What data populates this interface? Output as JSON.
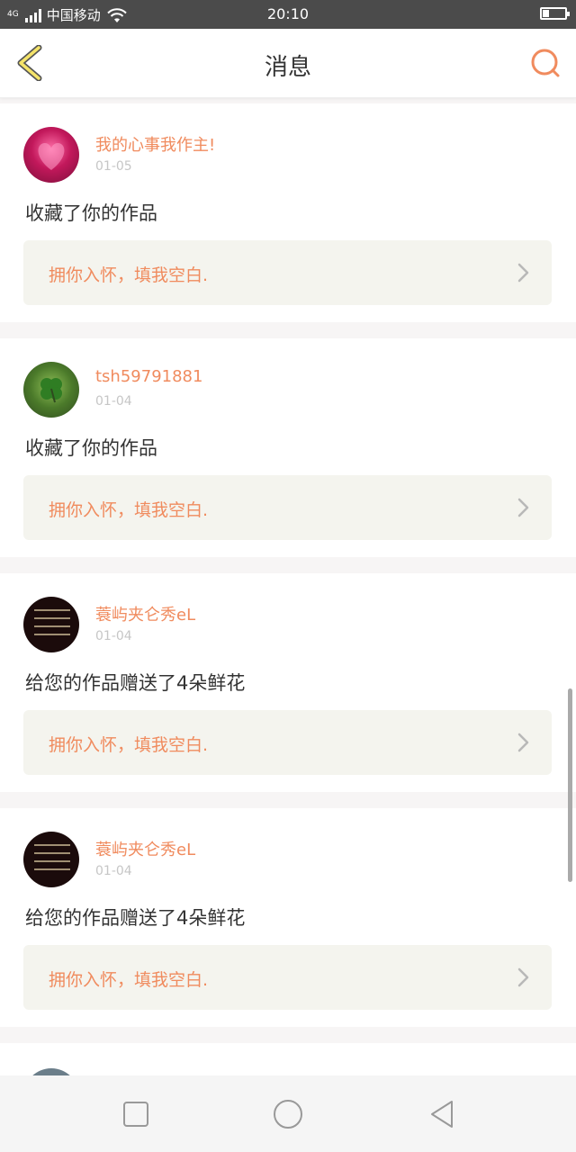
{
  "status_bar": {
    "network": "4G",
    "carrier": "中国移动",
    "time": "20:10",
    "battery_level": 0.25
  },
  "header": {
    "title": "消息",
    "back_icon": "chevron-left-icon",
    "search_icon": "search-icon",
    "accent_color": "#f08b5e"
  },
  "messages": [
    {
      "user": "我的心事我作主!",
      "date": "01-05",
      "action": "收藏了你的作品",
      "work_title": "拥你入怀，填我空白."
    },
    {
      "user": "tsh59791881",
      "date": "01-04",
      "action": "收藏了你的作品",
      "work_title": "拥你入怀，填我空白."
    },
    {
      "user": "蓑屿夹仑秀eL",
      "date": "01-04",
      "action": "给您的作品赠送了4朵鲜花",
      "work_title": "拥你入怀，填我空白."
    },
    {
      "user": "蓑屿夹仑秀eL",
      "date": "01-04",
      "action": "给您的作品赠送了4朵鲜花",
      "work_title": "拥你入怀，填我空白."
    }
  ],
  "nav_bar": {
    "recent_icon": "square-icon",
    "home_icon": "circle-icon",
    "back_icon": "triangle-back-icon"
  }
}
